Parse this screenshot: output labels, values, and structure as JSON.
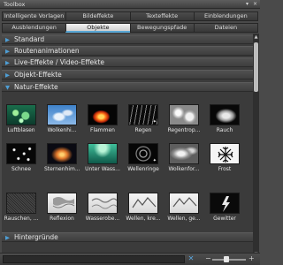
{
  "window": {
    "title": "Toolbox",
    "buttons": {
      "menu": "▾",
      "close": "×"
    }
  },
  "tabs": {
    "row1": [
      "Intelligente Vorlagen",
      "Bildeffekte",
      "Texteffekte",
      "Einblendungen"
    ],
    "row2": [
      "Ausblendungen",
      "Objekte",
      "Bewegungspfade",
      "Dateien"
    ],
    "active": "Objekte",
    "accent": "#58a6d4"
  },
  "sections": [
    {
      "label": "Standard",
      "expanded": false
    },
    {
      "label": "Routenanimationen",
      "expanded": false
    },
    {
      "label": "Live-Effekte / Video-Effekte",
      "expanded": false
    },
    {
      "label": "Objekt-Effekte",
      "expanded": false
    },
    {
      "label": "Natur-Effekte",
      "expanded": true
    },
    {
      "label": "Hintergründe",
      "expanded": false
    }
  ],
  "natur_items": [
    {
      "label": "Luftblasen",
      "icon": "air-bubbles-thumb"
    },
    {
      "label": "Wolkenhi...",
      "icon": "clouds-sky-thumb"
    },
    {
      "label": "Flammen",
      "icon": "flames-thumb"
    },
    {
      "label": "Regen",
      "icon": "rain-thumb"
    },
    {
      "label": "Regentrop...",
      "icon": "raindrops-thumb"
    },
    {
      "label": "Rauch",
      "icon": "smoke-thumb"
    },
    {
      "label": "Schnee",
      "icon": "snow-thumb"
    },
    {
      "label": "Sternenhim...",
      "icon": "starry-sky-thumb"
    },
    {
      "label": "Unter Wass...",
      "icon": "underwater-thumb"
    },
    {
      "label": "Wellenringe",
      "icon": "wave-rings-thumb"
    },
    {
      "label": "Wolkenfor...",
      "icon": "cloud-formation-thumb"
    },
    {
      "label": "Frost",
      "icon": "frost-thumb"
    },
    {
      "label": "Rauschen, ...",
      "icon": "noise-thumb"
    },
    {
      "label": "Reflexion",
      "icon": "reflection-thumb"
    },
    {
      "label": "Wasserobe...",
      "icon": "water-surface-thumb"
    },
    {
      "label": "Wellen, kre...",
      "icon": "waves-circular-thumb"
    },
    {
      "label": "Wellen, ge...",
      "icon": "waves-straight-thumb"
    },
    {
      "label": "Gewitter",
      "icon": "thunderstorm-thumb"
    }
  ],
  "bottom": {
    "search_value": "",
    "clear_icon": "clear-icon",
    "zoom_minus": "−",
    "zoom_plus": "+",
    "zoom_level": 0.4
  }
}
